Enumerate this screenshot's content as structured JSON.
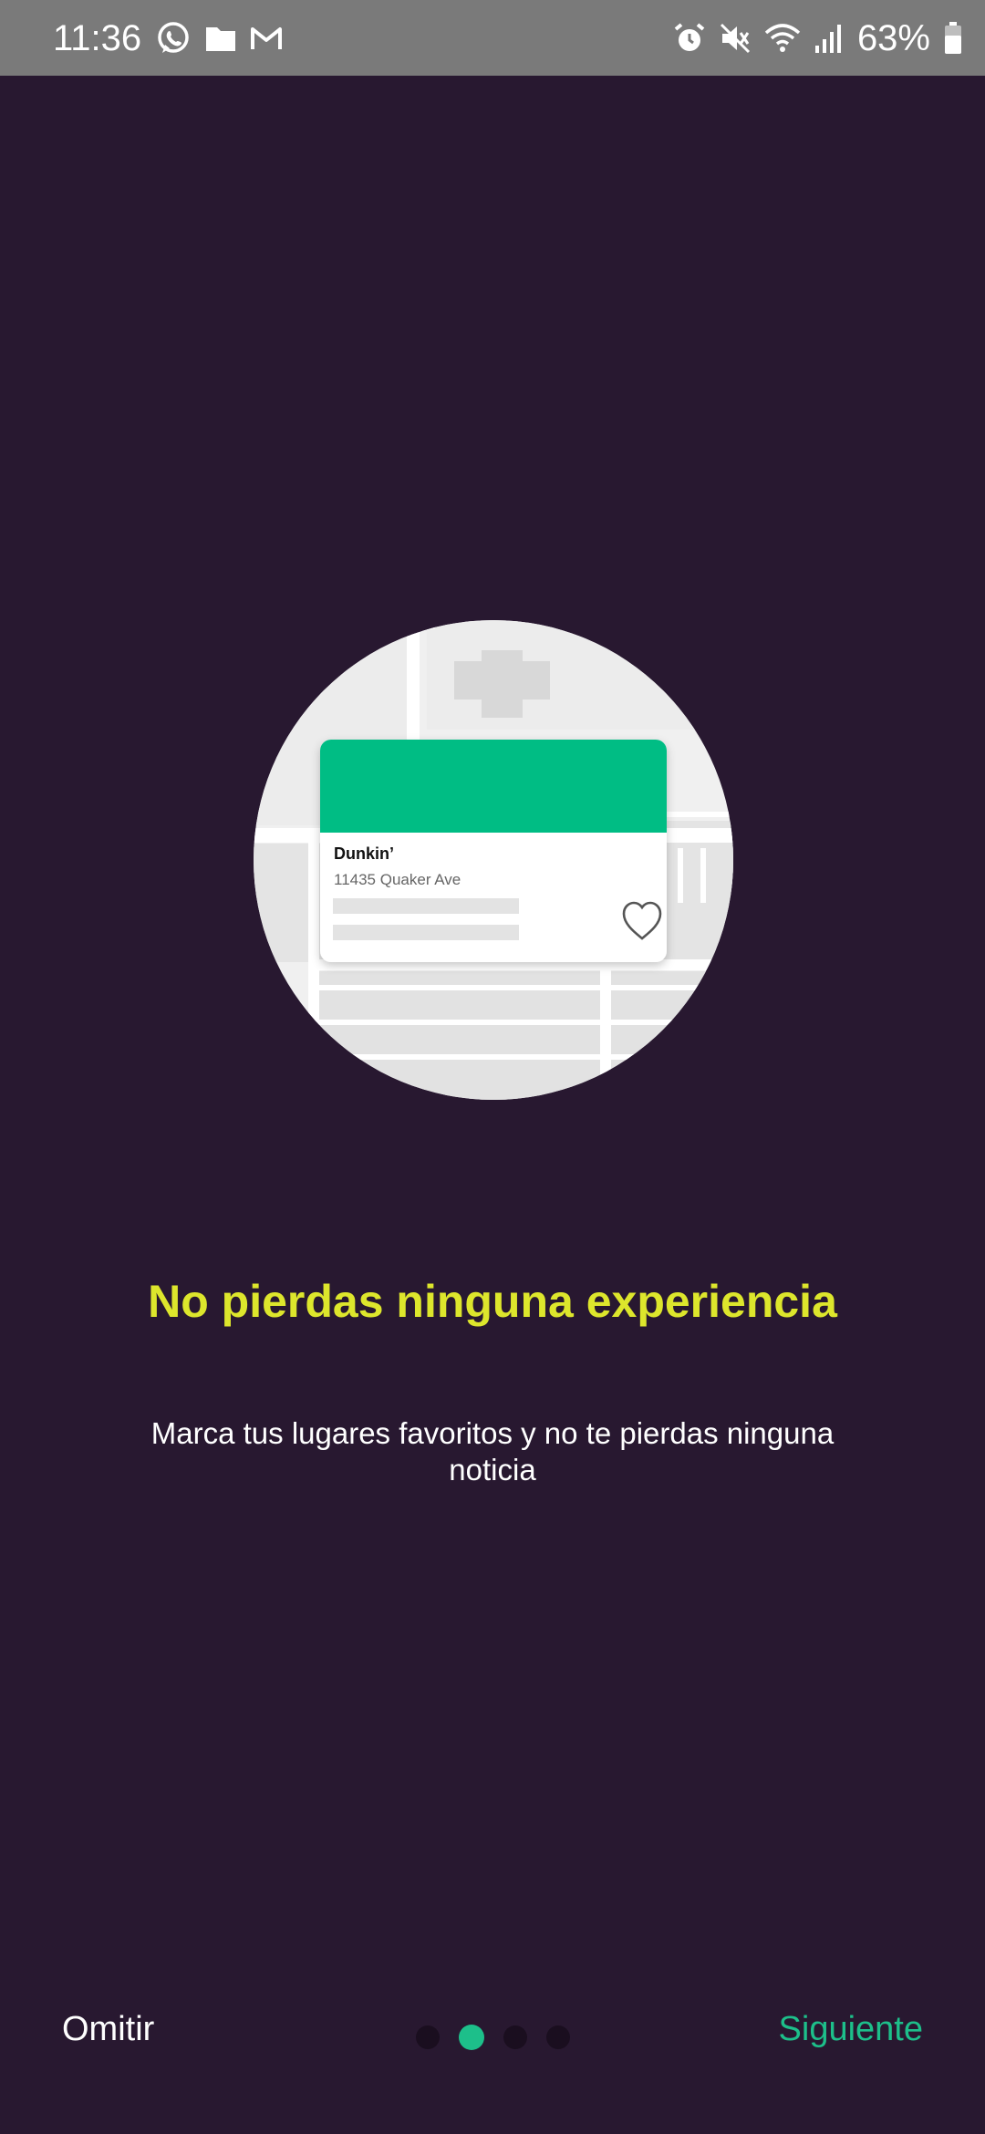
{
  "status_bar": {
    "time": "11:36",
    "battery": "63%",
    "left_icons": [
      "whatsapp-icon",
      "folder-icon",
      "gmail-icon"
    ],
    "right_icons": [
      "alarm-icon",
      "mute-icon",
      "wifi-icon",
      "signal-icon",
      "battery-icon"
    ]
  },
  "card": {
    "name": "Dunkin’",
    "address": "11435 Quaker Ave",
    "header_color": "#00bd84",
    "icon": "heart-icon"
  },
  "onboarding": {
    "title": "No pierdas ninguna experiencia",
    "description": "Marca tus lugares favoritos y no te pierdas ninguna noticia",
    "page_indicator": {
      "total": 4,
      "active_index": 1
    }
  },
  "buttons": {
    "skip": "Omitir",
    "next": "Siguiente"
  },
  "colors": {
    "background": "#281830",
    "title": "#dde62c",
    "accent": "#1dbf8a",
    "status_bar": "#7a7a7a"
  }
}
